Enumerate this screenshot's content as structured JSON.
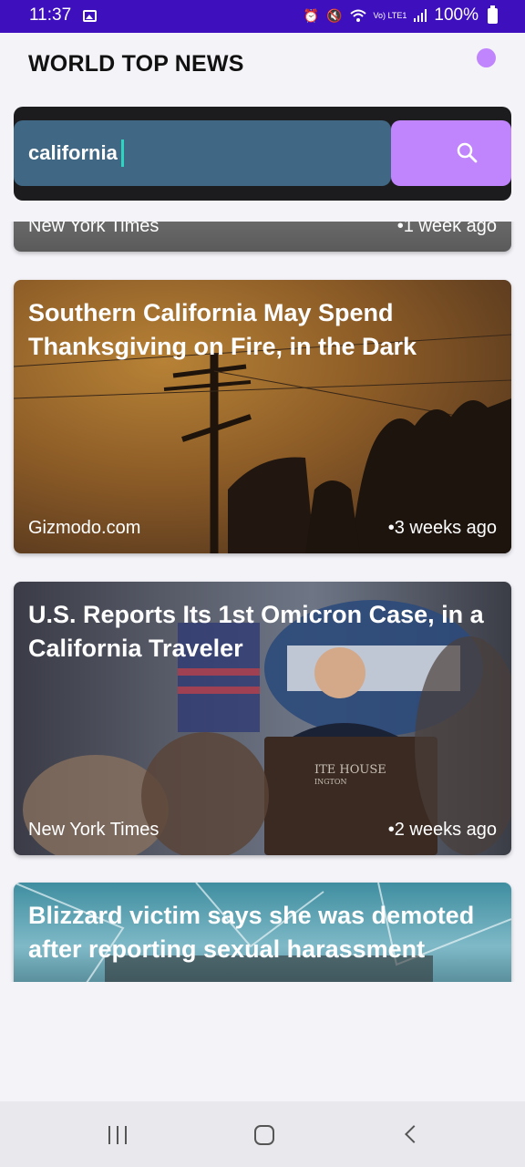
{
  "status_bar": {
    "time": "11:37",
    "battery": "100%",
    "network_label": "Vo) LTE1",
    "icons": [
      "gallery-icon",
      "alarm-icon",
      "mute-icon",
      "wifi-icon",
      "signal-icon",
      "battery-icon"
    ]
  },
  "app": {
    "title": "WORLD TOP NEWS",
    "accent_color": "#c084fc"
  },
  "search": {
    "value": "california",
    "button_icon": "search-icon"
  },
  "articles": [
    {
      "title": "",
      "source": "New York Times",
      "time": "•1 week ago"
    },
    {
      "title": "Southern California May Spend Thanksgiving on Fire, in the Dark",
      "source": "Gizmodo.com",
      "time": "•3 weeks ago"
    },
    {
      "title": "U.S. Reports Its 1st Omicron Case, in a California Traveler",
      "source": "New York Times",
      "time": "•2 weeks ago"
    },
    {
      "title": "Blizzard victim says she was demoted after reporting sexual harassment",
      "source": "",
      "time": ""
    }
  ],
  "nav": {
    "icons": [
      "recent-apps-icon",
      "home-icon",
      "back-icon"
    ]
  }
}
